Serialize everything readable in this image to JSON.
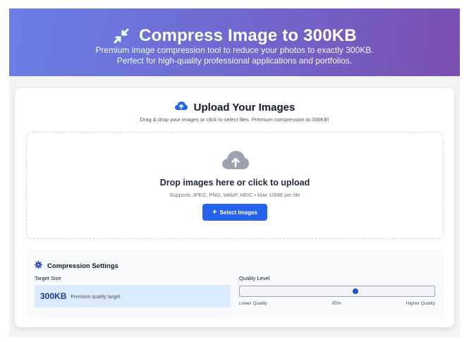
{
  "hero": {
    "title": "Compress Image to 300KB",
    "subtitle": "Premium image compression tool to reduce your photos to exactly 300KB. Perfect for high-quality professional applications and portfolios.",
    "icon": "compress-arrows-icon",
    "gradient_start": "#6a7fe6",
    "gradient_end": "#7a4fb0"
  },
  "upload": {
    "icon": "cloud-upload-icon",
    "title": "Upload Your Images",
    "subtitle": "Drag & drop your images or click to select files. Premium compression to 300KB!"
  },
  "dropzone": {
    "icon": "cloud-upload-icon",
    "title": "Drop images here or click to upload",
    "subtitle": "Supports JPEG, PNG, WebP, HEIC • Max 10MB per file",
    "button_label": "Select Images",
    "button_color": "#2563eb"
  },
  "settings": {
    "icon": "gear-icon",
    "title": "Compression Settings",
    "target_size_label": "Target Size",
    "target_size_value": "300KB",
    "target_size_note": "Premium quality target",
    "quality_label": "Quality Level",
    "quality_value": 85,
    "quality_value_text": "85%",
    "quality_min_label": "Lower Quality",
    "quality_max_label": "Higher Quality"
  }
}
